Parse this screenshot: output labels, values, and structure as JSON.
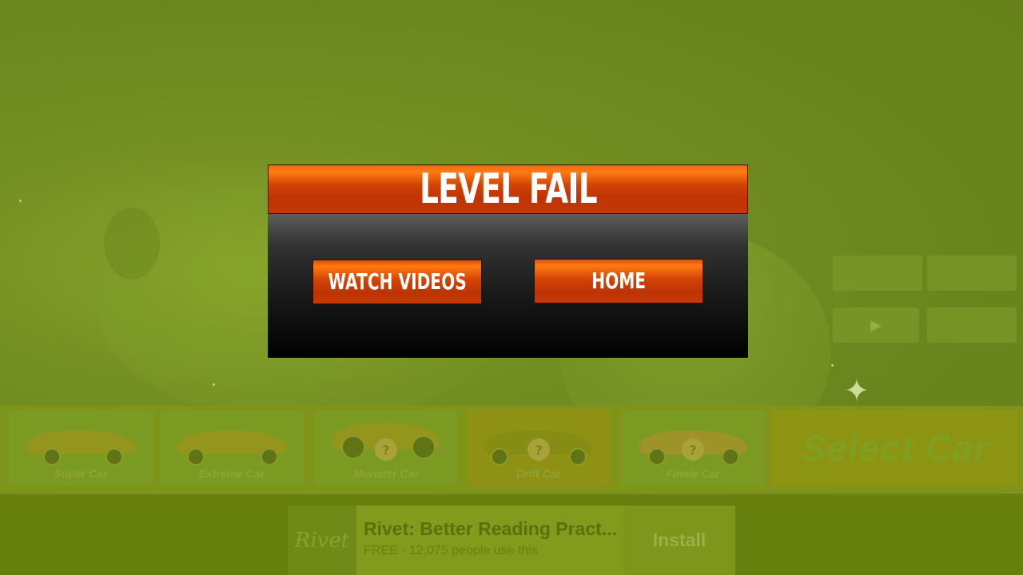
{
  "dialog": {
    "title": "LEVEL FAIL",
    "watch_videos_label": "WATCH VIDEOS",
    "home_label": "HOME"
  },
  "car_selection": {
    "heading": "Select Car",
    "cars": [
      {
        "label": "Super Car",
        "locked": false
      },
      {
        "label": "Extreme Car",
        "locked": false
      },
      {
        "label": "Monster Car",
        "locked": true
      },
      {
        "label": "Drift Car",
        "locked": true
      },
      {
        "label": "Finale Car",
        "locked": true
      }
    ]
  },
  "ad": {
    "title": "Rivet: Better Reading Pract...",
    "subtitle": "FREE · 12,075 people use this",
    "icon_text": "Rivet",
    "install_label": "Install"
  },
  "colors": {
    "overlay_green": "#6e8a1d",
    "button_orange": "#d44406",
    "button_highlight": "#ff7a10",
    "panel_black": "#000000",
    "text_white": "#ffffff"
  }
}
